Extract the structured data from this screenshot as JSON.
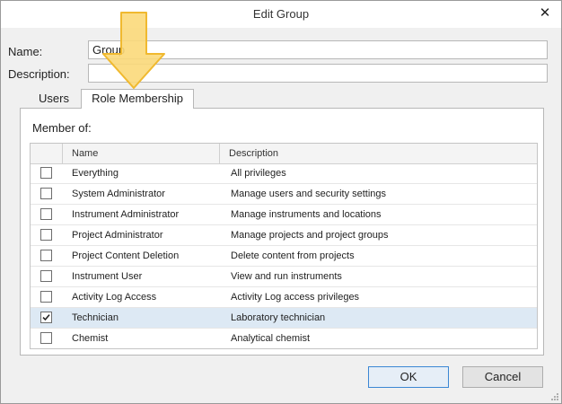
{
  "dialog": {
    "title": "Edit Group",
    "close_glyph": "✕"
  },
  "form": {
    "name_label": "Name:",
    "name_value": "Group",
    "description_label": "Description:",
    "description_value": ""
  },
  "tabs": [
    {
      "label": "Users",
      "active": false
    },
    {
      "label": "Role Membership",
      "active": true
    }
  ],
  "membership": {
    "heading": "Member of:",
    "columns": [
      "Name",
      "Description"
    ],
    "rows": [
      {
        "name": "Everything",
        "description": "All privileges",
        "checked": false
      },
      {
        "name": "System Administrator",
        "description": "Manage users and security settings",
        "checked": false
      },
      {
        "name": "Instrument Administrator",
        "description": "Manage instruments and locations",
        "checked": false
      },
      {
        "name": "Project Administrator",
        "description": "Manage projects and project groups",
        "checked": false
      },
      {
        "name": "Project Content Deletion",
        "description": "Delete content from projects",
        "checked": false
      },
      {
        "name": "Instrument User",
        "description": "View and run instruments",
        "checked": false
      },
      {
        "name": "Activity Log Access",
        "description": "Activity Log access privileges",
        "checked": false
      },
      {
        "name": "Technician",
        "description": "Laboratory technician",
        "checked": true,
        "selected": true
      },
      {
        "name": "Chemist",
        "description": "Analytical chemist",
        "checked": false
      }
    ]
  },
  "buttons": {
    "ok": "OK",
    "cancel": "Cancel"
  },
  "colors": {
    "selected_row": "#dde9f4",
    "default_button_border": "#3b87d4",
    "arrow_fill": "#fbd97a",
    "arrow_stroke": "#f0b92f"
  },
  "icons": {
    "close": "close-icon",
    "checkmark": "checkmark-icon",
    "arrow": "arrow-down-icon",
    "resize": "resize-grip-icon"
  }
}
